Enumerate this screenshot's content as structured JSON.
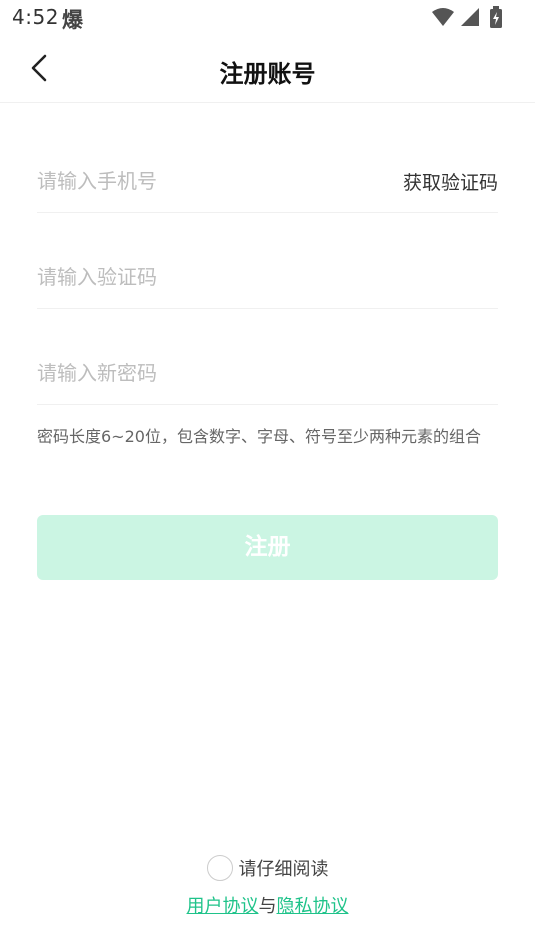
{
  "status_bar": {
    "time": "4:52",
    "notify_glyph": "爆",
    "icons": [
      "wifi-icon",
      "signal-icon",
      "battery-icon"
    ]
  },
  "header": {
    "back_icon": "chevron-left-icon",
    "title": "注册账号"
  },
  "form": {
    "phone": {
      "placeholder": "请输入手机号",
      "value": ""
    },
    "get_code_label": "获取验证码",
    "code": {
      "placeholder": "请输入验证码",
      "value": ""
    },
    "password": {
      "placeholder": "请输入新密码",
      "value": ""
    },
    "hint": "密码长度6~20位，包含数字、字母、符号至少两种元素的组合"
  },
  "register_label": "注册",
  "agreement": {
    "read_label": "请仔细阅读",
    "user_agreement": "用户协议",
    "separator": "与",
    "privacy_agreement": "隐私协议"
  },
  "colors": {
    "accent": "#1fc38a",
    "button_disabled_bg": "#cbf5e3",
    "placeholder": "#bdbdbd"
  }
}
